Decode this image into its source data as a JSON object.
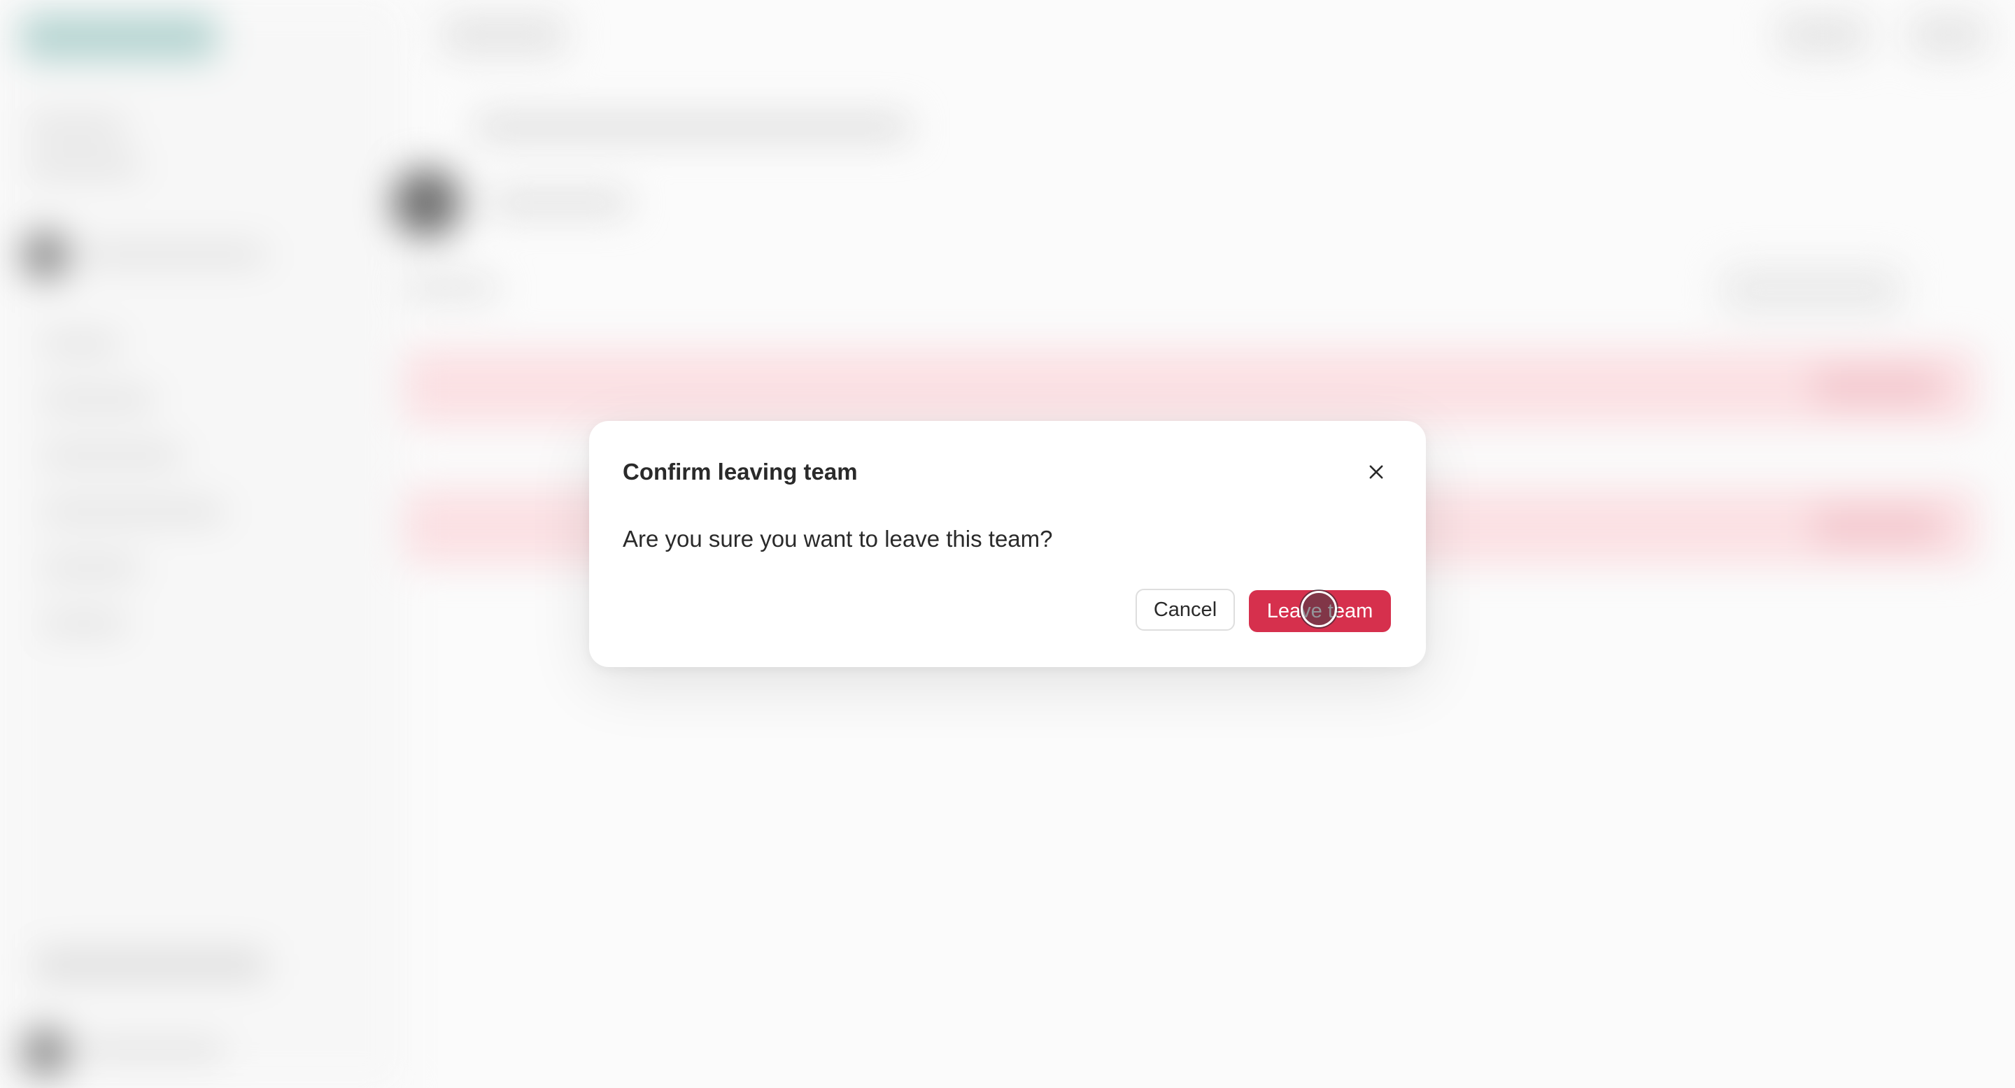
{
  "dialog": {
    "title": "Confirm leaving team",
    "message": "Are you sure you want to leave this team?",
    "close_icon": "close-icon",
    "cancel_label": "Cancel",
    "confirm_label": "Leave team"
  },
  "colors": {
    "danger": "#d6304d",
    "overlay_background": "#fbfbfb",
    "dialog_background": "#ffffff",
    "text": "#2a2a2a"
  }
}
